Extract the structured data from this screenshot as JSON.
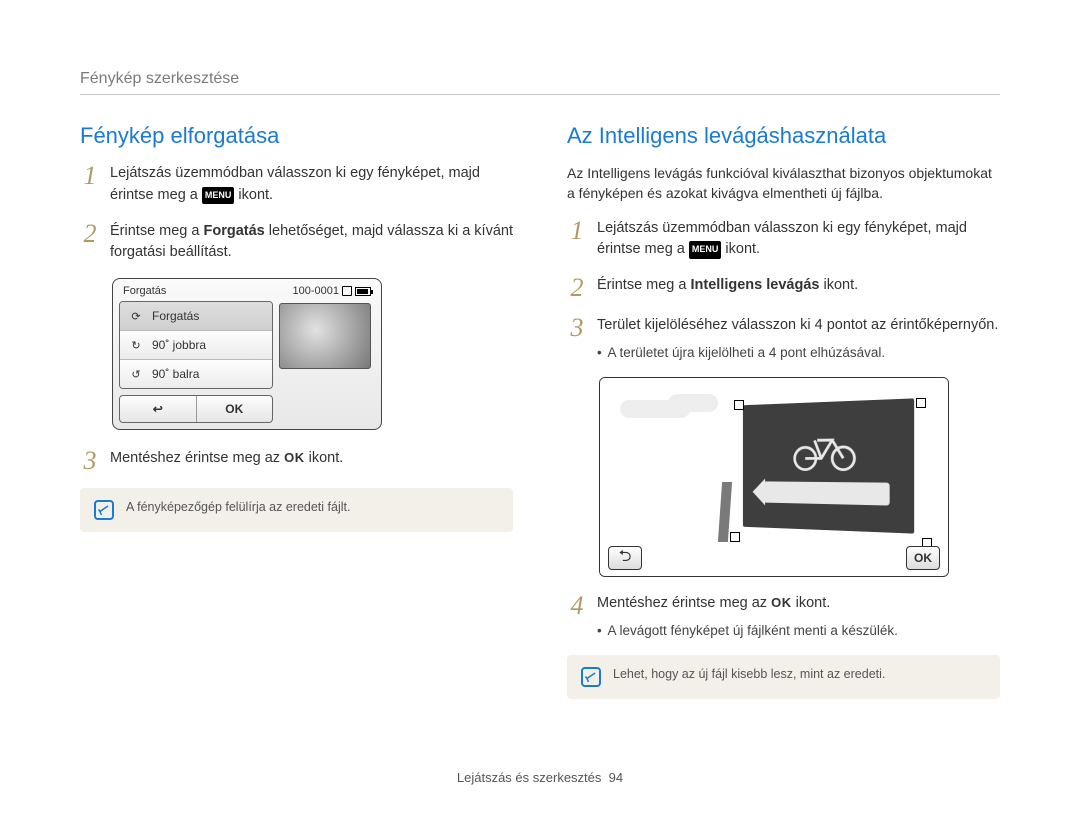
{
  "breadcrumb": "Fénykép szerkesztése",
  "left": {
    "title": "Fénykép elforgatása",
    "steps": {
      "s1_a": "Lejátszás üzemmódban válasszon ki egy fényképet, majd érintse meg a ",
      "s1_b": " ikont.",
      "s2_a": "Érintse meg a ",
      "s2_bold": "Forgatás",
      "s2_b": " lehetőséget, majd válassza ki a kívánt forgatási beállítást.",
      "s3_a": "Mentéshez érintse meg az ",
      "s3_b": " ikont."
    },
    "menu_icon_label": "MENU",
    "ok_label": "OK",
    "device": {
      "header_label": "Forgatás",
      "counter": "100-0001",
      "items": [
        "Forgatás",
        "90˚ jobbra",
        "90˚ balra"
      ],
      "back_glyph": "↩",
      "ok": "OK"
    },
    "note": "A fényképezőgép felülírja az eredeti fájlt."
  },
  "right": {
    "title": "Az Intelligens levágáshasználata",
    "intro": "Az Intelligens levágás funkcióval kiválaszthat bizonyos objektumokat a fényképen és azokat kivágva elmentheti új fájlba.",
    "steps": {
      "s1_a": "Lejátszás üzemmódban válasszon ki egy fényképet, majd érintse meg a ",
      "s1_b": " ikont.",
      "s2_a": "Érintse meg a ",
      "s2_bold": "Intelligens levágás",
      "s2_b": " ikont.",
      "s3": "Terület kijelöléséhez válasszon ki 4 pontot az érintőképernyőn.",
      "s3_bullet": "A területet újra kijelölheti a 4 pont elhúzásával.",
      "s4_a": "Mentéshez érintse meg az ",
      "s4_b": " ikont.",
      "s4_bullet": "A levágott fényképet új fájlként menti a készülék."
    },
    "menu_icon_label": "MENU",
    "ok_label": "OK",
    "illus": {
      "back_glyph": "⮌",
      "ok": "OK"
    },
    "note": "Lehet, hogy az új fájl kisebb lesz, mint az eredeti."
  },
  "footer": {
    "label": "Lejátszás és szerkesztés",
    "page": "94"
  }
}
